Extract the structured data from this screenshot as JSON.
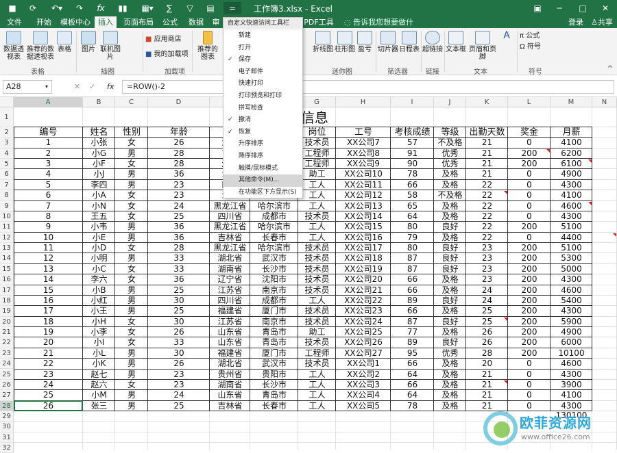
{
  "window": {
    "title": "工作簿3.xlsx - Excel",
    "login": "登录",
    "share": "共享",
    "qa_customize": "="
  },
  "tabs": [
    "文件",
    "开始",
    "模板中心",
    "插入",
    "页面布局",
    "公式",
    "数据",
    "审",
    "PDF工具集",
    "告诉我您想要做什么..."
  ],
  "ribbon": {
    "buttons": [
      "数据透视表",
      "推荐的数据透视表",
      "表格",
      "图片",
      "联机图片",
      "应用商店",
      "我的加载项",
      "推荐的图表",
      "折线图",
      "柱形图",
      "盈亏",
      "切片器",
      "日程表",
      "超链接",
      "文本框",
      "页眉和页脚",
      "公式",
      "符号"
    ],
    "groups": [
      "表格",
      "插图",
      "加载项",
      "迷你图",
      "筛选器",
      "链接",
      "文本",
      "符号"
    ]
  },
  "formula_bar": {
    "name_box": "A28",
    "fx": "fx",
    "formula": "=ROW()-2"
  },
  "columns": [
    "A",
    "B",
    "C",
    "D",
    "E",
    "F",
    "G",
    "H",
    "I",
    "J",
    "K",
    "L",
    "M",
    "N"
  ],
  "sheet": {
    "title": "XX         信息",
    "headers": [
      "编号",
      "姓名",
      "性别",
      "年龄",
      "省",
      "",
      "岗位",
      "工号",
      "考核成绩",
      "等级",
      "出勤天数",
      "奖金",
      "月薪"
    ],
    "rows": [
      [
        "1",
        "小张",
        "女",
        "26",
        "湖南",
        "",
        "技术员",
        "XX公司7",
        "57",
        "不及格",
        "21",
        "0",
        "4100"
      ],
      [
        "2",
        "小G",
        "男",
        "28",
        "吉林",
        "",
        "工程师",
        "XX公司8",
        "91",
        "优秀",
        "21",
        "200",
        "6200"
      ],
      [
        "3",
        "小F",
        "女",
        "28",
        "辽宁",
        "",
        "工程师",
        "XX公司9",
        "90",
        "优秀",
        "21",
        "200",
        "6100"
      ],
      [
        "4",
        "小J",
        "男",
        "36",
        "江苏",
        "",
        "助工",
        "XX公司10",
        "78",
        "及格",
        "21",
        "0",
        "4900"
      ],
      [
        "5",
        "李四",
        "男",
        "23",
        "四川",
        "",
        "工人",
        "XX公司11",
        "66",
        "及格",
        "22",
        "0",
        "4300"
      ],
      [
        "6",
        "小A",
        "女",
        "23",
        "湖北",
        "",
        "工人",
        "XX公司12",
        "58",
        "不及格",
        "22",
        "0",
        "4100"
      ],
      [
        "7",
        "小N",
        "女",
        "24",
        "黑龙江省",
        "哈尔滨市",
        "工人",
        "XX公司13",
        "65",
        "及格",
        "22",
        "0",
        "4600"
      ],
      [
        "8",
        "王五",
        "女",
        "25",
        "四川省",
        "成都市",
        "技术员",
        "XX公司14",
        "64",
        "及格",
        "22",
        "0",
        "4300"
      ],
      [
        "9",
        "小韦",
        "男",
        "36",
        "黑龙江省",
        "哈尔滨市",
        "工人",
        "XX公司15",
        "80",
        "良好",
        "22",
        "200",
        "5100"
      ],
      [
        "10",
        "小E",
        "男",
        "36",
        "吉林省",
        "长春市",
        "工人",
        "XX公司16",
        "79",
        "及格",
        "22",
        "0",
        "4400"
      ],
      [
        "11",
        "小D",
        "女",
        "28",
        "黑龙江省",
        "哈尔滨市",
        "技术员",
        "XX公司17",
        "80",
        "良好",
        "23",
        "200",
        "5100"
      ],
      [
        "12",
        "小明",
        "男",
        "33",
        "湖北省",
        "武汉市",
        "技术员",
        "XX公司18",
        "87",
        "良好",
        "23",
        "200",
        "5300"
      ],
      [
        "13",
        "小C",
        "女",
        "33",
        "湖南省",
        "长沙市",
        "技术员",
        "XX公司19",
        "87",
        "良好",
        "23",
        "200",
        "5000"
      ],
      [
        "14",
        "李六",
        "女",
        "36",
        "辽宁省",
        "沈阳市",
        "技术员",
        "XX公司20",
        "66",
        "及格",
        "23",
        "200",
        "4300"
      ],
      [
        "15",
        "小B",
        "男",
        "25",
        "江苏省",
        "南京市",
        "技术员",
        "XX公司21",
        "66",
        "及格",
        "24",
        "200",
        "4600"
      ],
      [
        "16",
        "小红",
        "男",
        "30",
        "四川省",
        "成都市",
        "工人",
        "XX公司22",
        "89",
        "良好",
        "24",
        "200",
        "5400"
      ],
      [
        "17",
        "小王",
        "男",
        "25",
        "福建省",
        "厦门市",
        "技术员",
        "XX公司23",
        "66",
        "及格",
        "25",
        "200",
        "4300"
      ],
      [
        "18",
        "小H",
        "女",
        "30",
        "江苏省",
        "南京市",
        "技术员",
        "XX公司24",
        "87",
        "良好",
        "25",
        "200",
        "5900"
      ],
      [
        "19",
        "小李",
        "女",
        "26",
        "山东省",
        "青岛市",
        "助工",
        "XX公司25",
        "77",
        "及格",
        "26",
        "200",
        "4900"
      ],
      [
        "20",
        "小I",
        "女",
        "33",
        "山东省",
        "青岛市",
        "技术员",
        "XX公司26",
        "89",
        "良好",
        "26",
        "200",
        "6000"
      ],
      [
        "21",
        "小L",
        "男",
        "30",
        "福建省",
        "厦门市",
        "工程师",
        "XX公司27",
        "95",
        "优秀",
        "28",
        "200",
        "10100"
      ],
      [
        "22",
        "小K",
        "男",
        "26",
        "湖北省",
        "武汉市",
        "技术员",
        "XX公司1",
        "66",
        "及格",
        "20",
        "0",
        "4600"
      ],
      [
        "23",
        "赵七",
        "男",
        "23",
        "贵州省",
        "贵阳市",
        "工人",
        "XX公司2",
        "64",
        "及格",
        "21",
        "0",
        "4300"
      ],
      [
        "24",
        "赵六",
        "女",
        "23",
        "湖南省",
        "长沙市",
        "工人",
        "XX公司3",
        "66",
        "及格",
        "21",
        "0",
        "3900"
      ],
      [
        "25",
        "小M",
        "男",
        "24",
        "山东省",
        "青岛市",
        "工人",
        "XX公司4",
        "64",
        "及格",
        "21",
        "0",
        "4100"
      ],
      [
        "26",
        "张三",
        "男",
        "25",
        "吉林省",
        "长春市",
        "工人",
        "XX公司5",
        "78",
        "及格",
        "21",
        "0",
        "4300"
      ]
    ],
    "total": "130100"
  },
  "menu": {
    "header": "自定义快速访问工具栏",
    "items": [
      {
        "label": "新建",
        "checked": false
      },
      {
        "label": "打开",
        "checked": false
      },
      {
        "label": "保存",
        "checked": true
      },
      {
        "label": "电子邮件",
        "checked": false
      },
      {
        "label": "快速打印",
        "checked": false
      },
      {
        "label": "打印预览和打印",
        "checked": false
      },
      {
        "label": "拼写检查",
        "checked": false
      },
      {
        "label": "撤消",
        "checked": true
      },
      {
        "label": "恢复",
        "checked": true
      },
      {
        "label": "升序排序",
        "checked": false
      },
      {
        "label": "降序排序",
        "checked": false
      },
      {
        "label": "触摸/鼠标模式",
        "checked": false
      },
      {
        "label": "其他命令(M)...",
        "checked": false
      },
      {
        "label": "在功能区下方显示(S)",
        "checked": false
      }
    ]
  },
  "watermark": {
    "text": "欧菲资源网",
    "url": "www.office26.com"
  },
  "colors": {
    "excel_green": "#217346",
    "menu_highlight": "#d6d6d6"
  }
}
